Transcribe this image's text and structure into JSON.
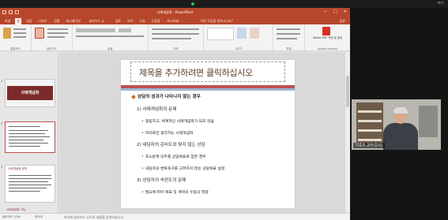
{
  "app": {
    "window_title": "사례개념화 - PowerPoint",
    "share_label": "공유"
  },
  "ribbon": {
    "tabs": [
      "파일",
      "홈",
      "삽입",
      "디자인",
      "전환",
      "애니메이션",
      "슬라이드 쇼",
      "검토",
      "보기",
      "녹음",
      "도움말",
      "Acrobat"
    ],
    "active_tab_index": 1,
    "search_label": "어떤 작업을 원하시나요?",
    "groups": [
      "클립보드",
      "슬라이드",
      "글꼴",
      "단락",
      "그리기",
      "편집",
      "Adobe Acrobat"
    ],
    "acrobat_button": "Adobe PDF 작성 및 공유"
  },
  "thumbnails": [
    {
      "num": "1",
      "title": "사례개념화"
    },
    {
      "num": "2",
      "title": "사례개념화 정의"
    },
    {
      "num": "3",
      "title": "사례개념화 기능"
    }
  ],
  "slide": {
    "title_placeholder": "제목을 추가하려면 클릭하십시오",
    "items": [
      {
        "level": 0,
        "text": "상담의 성과가 나타나지 않는 경우"
      },
      {
        "level": 1,
        "text": "1) 사례개념화의 문제"
      },
      {
        "level": 2,
        "text": "정립하고, 체계적인 사례개념화가 되지 않음"
      },
      {
        "level": 2,
        "text": "머리로만 생각하는 사례개념화"
      },
      {
        "level": 1,
        "text": "2) 내담자의 준비도와 맞지 않는 상담"
      },
      {
        "level": 2,
        "text": "호소문제 모두를 상담목표로 잡은 경우"
      },
      {
        "level": 2,
        "text": "내담자의 변화욕구를 고려하지 않는 상담목표 설정"
      },
      {
        "level": 1,
        "text": "3) 상담자의 숙련도의 문제"
      },
      {
        "level": 2,
        "text": "필요에 따라 목표 및 계획의 수립의 역량"
      }
    ]
  },
  "notes": {
    "placeholder": "여기에 슬라이드 노트의 내용을 입력하십시오"
  },
  "status": {
    "slide_info": "슬라이드 2/16",
    "language": "한국어"
  },
  "meeting": {
    "view_label": "보기",
    "speaker_name": "박종욱 교수(강사)"
  },
  "colors": {
    "ppt_accent": "#b7472a",
    "slide_accent": "#c0504d",
    "bullet": "#c56b1e"
  }
}
